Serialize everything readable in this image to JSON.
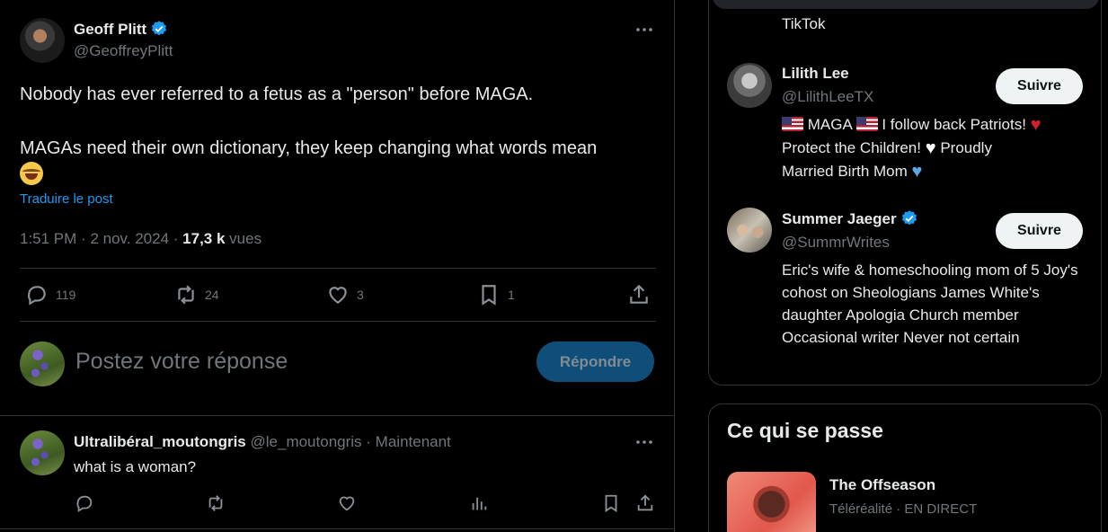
{
  "post": {
    "author_name": "Geoff Plitt",
    "author_handle": "@GeoffreyPlitt",
    "text_line1": "Nobody has ever referred to a fetus as a \"person\" before MAGA.",
    "text_line2": "MAGAs need their own dictionary, they keep changing what words mean",
    "emoji_icon": "face-with-tears-of-joy",
    "translate_label": "Traduire le post",
    "time": "1:51 PM",
    "date": "2 nov. 2024",
    "views_count": "17,3 k",
    "views_label": "vues",
    "stats": {
      "replies": "119",
      "reposts": "24",
      "likes": "3",
      "bookmarks": "1"
    }
  },
  "composer": {
    "placeholder": "Postez votre réponse",
    "reply_button": "Répondre"
  },
  "reply": {
    "author_name": "Ultralibéral_moutongris",
    "author_handle": "@le_moutongris",
    "time": "Maintenant",
    "text": "what is a woman?"
  },
  "sidebar": {
    "prev_bio_tail": "TikTok",
    "suggestions": [
      {
        "name": "Lilith Lee",
        "handle": "@LilithLeeTX",
        "follow_label": "Suivre",
        "bio_line1_a": "MAGA",
        "bio_line1_b": "I follow back Patriots!",
        "bio_line2": "Protect the Children!",
        "bio_line2_b": "Proudly",
        "bio_line3": "Married Birth Mom"
      },
      {
        "name": "Summer Jaeger",
        "handle": "@SummrWrites",
        "follow_label": "Suivre",
        "bio": "Eric's wife & homeschooling mom of 5 Joy's cohost on Sheologians James White's daughter Apologia Church member Occasional writer Never not certain"
      }
    ],
    "trends_title": "Ce qui se passe",
    "trend": {
      "title": "The Offseason",
      "category": "Téléréalité",
      "status": "EN DIRECT"
    }
  },
  "colors": {
    "accent": "#1d9bf0",
    "muted": "#71767b",
    "text": "#e7e9ea",
    "border": "#2f3336"
  }
}
